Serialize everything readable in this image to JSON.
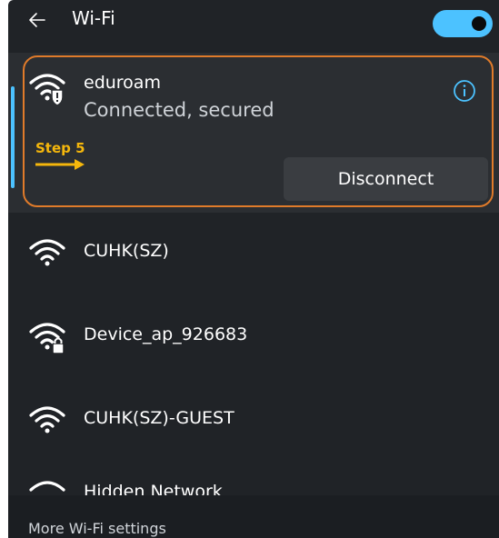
{
  "header": {
    "title": "Wi-Fi",
    "toggle_state": "on"
  },
  "connected_network": {
    "name": "eduroam",
    "status": "Connected, secured",
    "disconnect_label": "Disconnect",
    "icon": "wifi-secured-warning-icon"
  },
  "annotation": {
    "step_label": "Step 5",
    "highlight_color": "#e07b2a",
    "label_color": "#f5b70c"
  },
  "networks": [
    {
      "name": "CUHK(SZ)",
      "icon": "wifi-icon"
    },
    {
      "name": "Device_ap_926683",
      "icon": "wifi-lock-icon"
    },
    {
      "name": "CUHK(SZ)-GUEST",
      "icon": "wifi-icon"
    },
    {
      "name": "Hidden Network",
      "icon": "wifi-icon"
    }
  ],
  "footer": {
    "settings_link": "More Wi-Fi settings"
  },
  "colors": {
    "accent": "#4cc2ff",
    "background": "#202327"
  }
}
